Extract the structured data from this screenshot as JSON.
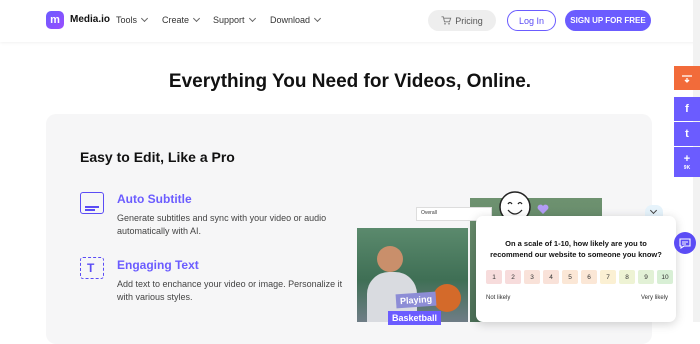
{
  "brand": {
    "logo_glyph": "m",
    "name": "Media.io",
    "accent": "#6b5cff"
  },
  "nav": {
    "items": [
      {
        "label": "Tools"
      },
      {
        "label": "Create"
      },
      {
        "label": "Support"
      },
      {
        "label": "Download"
      }
    ],
    "pricing_label": "Pricing",
    "login_label": "Log In",
    "signup_label": "SIGN UP FOR FREE"
  },
  "hero": {
    "title": "Everything You Need for Videos, Online."
  },
  "section": {
    "title": "Easy to Edit, Like a Pro",
    "features": [
      {
        "title": "Auto Subtitle",
        "desc": "Generate subtitles and sync with your video or audio automatically with AI.",
        "icon": "subtitle-icon"
      },
      {
        "title": "Engaging Text",
        "desc": "Add text to enchance your video or image. Personalize it with various styles.",
        "icon": "text-icon"
      }
    ]
  },
  "preview": {
    "editor_label": "Overall",
    "tag_playing": "Playing",
    "tag_basketball": "Basketball"
  },
  "survey": {
    "question": "On a scale of 1-10, how likely are you to recommend our website to someone you know?",
    "scale": [
      {
        "label": "1",
        "color": "#f7dcdc"
      },
      {
        "label": "2",
        "color": "#f7dcdc"
      },
      {
        "label": "3",
        "color": "#f9e2d9"
      },
      {
        "label": "4",
        "color": "#f9e2d9"
      },
      {
        "label": "5",
        "color": "#fbe7d6"
      },
      {
        "label": "6",
        "color": "#fbe7d6"
      },
      {
        "label": "7",
        "color": "#fbf0d3"
      },
      {
        "label": "8",
        "color": "#eef3d4"
      },
      {
        "label": "9",
        "color": "#e2f1d6"
      },
      {
        "label": "10",
        "color": "#d8efd5"
      }
    ],
    "low_label": "Not likely",
    "high_label": "Very likely"
  },
  "social": [
    {
      "icon": "share-download-icon",
      "color": "#f26b3a"
    },
    {
      "icon": "facebook-icon",
      "glyph": "f",
      "color": "#6b5cff"
    },
    {
      "icon": "twitter-icon",
      "glyph": "t",
      "color": "#6b5cff"
    },
    {
      "icon": "plus-icon",
      "glyph": "+",
      "sub": "9K",
      "color": "#6b5cff"
    }
  ]
}
